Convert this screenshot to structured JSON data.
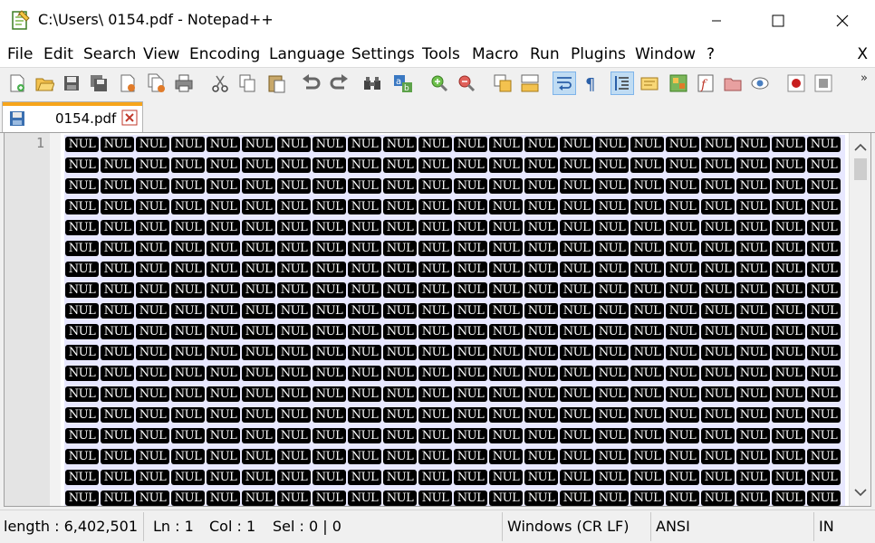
{
  "window": {
    "title": "C:\\Users\\ 0154.pdf - Notepad++",
    "controls": {
      "minimize": "minimize",
      "maximize": "maximize",
      "close": "close"
    }
  },
  "menu": {
    "items": [
      "File",
      "Edit",
      "Search",
      "View",
      "Encoding",
      "Language",
      "Settings",
      "Tools",
      "Macro",
      "Run",
      "Plugins",
      "Window",
      "?"
    ],
    "close_label": "X"
  },
  "toolbar": {
    "buttons": [
      "new-file",
      "open-file",
      "save",
      "save-all",
      "close",
      "close-all",
      "print",
      "cut",
      "copy",
      "paste",
      "undo",
      "redo",
      "find",
      "replace",
      "zoom-in",
      "zoom-out",
      "sync-vertical",
      "sync-horizontal",
      "word-wrap",
      "show-all-characters",
      "indent-guide",
      "user-defined-language",
      "document-map",
      "function-list",
      "folder-as-workspace",
      "monitoring",
      "record-macro",
      "stop-recording"
    ],
    "active_buttons": [
      "word-wrap",
      "indent-guide"
    ],
    "overflow": "»"
  },
  "tabs": [
    {
      "label": "0154.pdf",
      "accent_color": "#f7a51b"
    }
  ],
  "editor": {
    "line_number": "1",
    "token": "NUL",
    "tokens_per_row": 22,
    "visible_rows": 18,
    "background": "#e8e8ff",
    "token_background": "#000000",
    "token_color": "#ffffff"
  },
  "status": {
    "length": "length : 6,402,501",
    "line": "Ln : 1",
    "column": "Col : 1",
    "selection": "Sel : 0 | 0",
    "eol": "Windows (CR LF)",
    "encoding": "ANSI",
    "mode": "IN"
  }
}
